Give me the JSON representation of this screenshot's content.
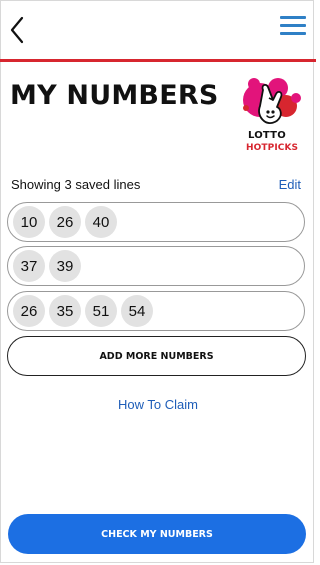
{
  "header": {
    "back_icon": "chevron-left-icon",
    "menu_icon": "hamburger-menu-icon",
    "accent_color": "#d7262f",
    "menu_color": "#2f80c6"
  },
  "page": {
    "title": "MY NUMBERS"
  },
  "logo": {
    "line1": "LOTTO",
    "line2": "HOTPICKS"
  },
  "saved": {
    "label": "Showing 3 saved lines",
    "edit_label": "Edit"
  },
  "lines": [
    [
      "10",
      "26",
      "40"
    ],
    [
      "37",
      "39"
    ],
    [
      "26",
      "35",
      "51",
      "54"
    ]
  ],
  "actions": {
    "add_more_label": "ADD MORE NUMBERS",
    "how_to_claim_label": "How To Claim",
    "check_label": "CHECK MY NUMBERS",
    "primary_color": "#1c6fe3",
    "link_color": "#1f5eb8"
  }
}
